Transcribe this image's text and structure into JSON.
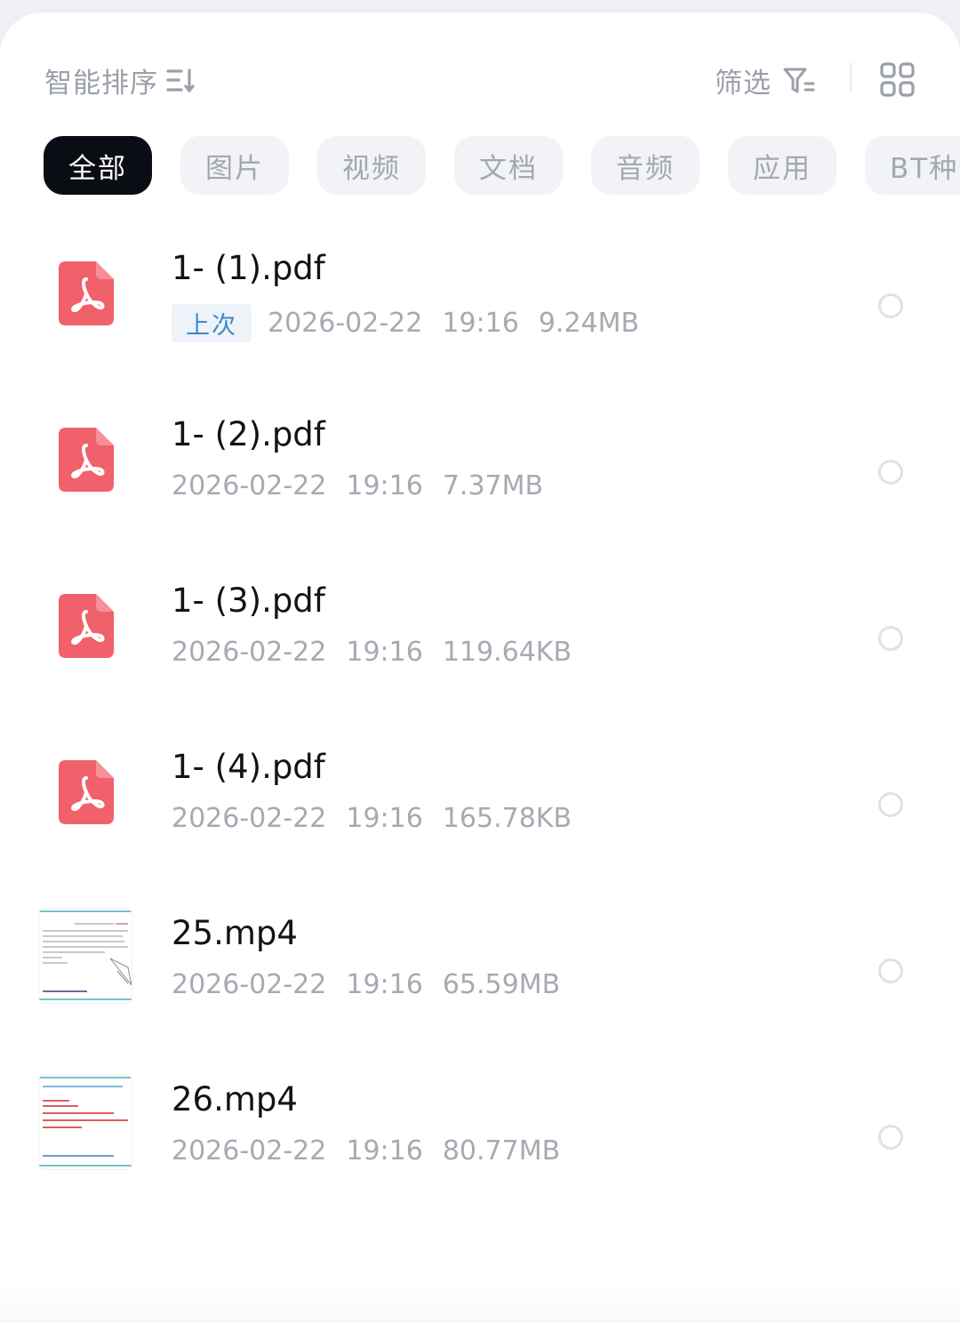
{
  "toolbar": {
    "sort_label": "智能排序",
    "sort_icon": "sort-icon",
    "filter_label": "筛选",
    "filter_icon": "filter-icon",
    "view_toggle_icon": "grid-view-icon"
  },
  "tabs": [
    {
      "label": "全部",
      "active": true
    },
    {
      "label": "图片",
      "active": false
    },
    {
      "label": "视频",
      "active": false
    },
    {
      "label": "文档",
      "active": false
    },
    {
      "label": "音频",
      "active": false
    },
    {
      "label": "应用",
      "active": false
    },
    {
      "label": "BT种子",
      "active": false
    }
  ],
  "files": [
    {
      "name": "1- (1).pdf",
      "type": "pdf",
      "badge": "上次",
      "date": "2026-02-22",
      "time": "19:16",
      "size": "9.24MB"
    },
    {
      "name": "1- (2).pdf",
      "type": "pdf",
      "date": "2026-02-22",
      "time": "19:16",
      "size": "7.37MB"
    },
    {
      "name": "1- (3).pdf",
      "type": "pdf",
      "date": "2026-02-22",
      "time": "19:16",
      "size": "119.64KB"
    },
    {
      "name": "1- (4).pdf",
      "type": "pdf",
      "date": "2026-02-22",
      "time": "19:16",
      "size": "165.78KB"
    },
    {
      "name": "25.mp4",
      "type": "video",
      "date": "2026-02-22",
      "time": "19:16",
      "size": "65.59MB"
    },
    {
      "name": "26.mp4",
      "type": "video",
      "date": "2026-02-22",
      "time": "19:16",
      "size": "80.77MB"
    }
  ],
  "colors": {
    "pdf_icon": "#f0616b",
    "active_tab_bg": "#0b0d14",
    "badge_text": "#3d88c7"
  }
}
